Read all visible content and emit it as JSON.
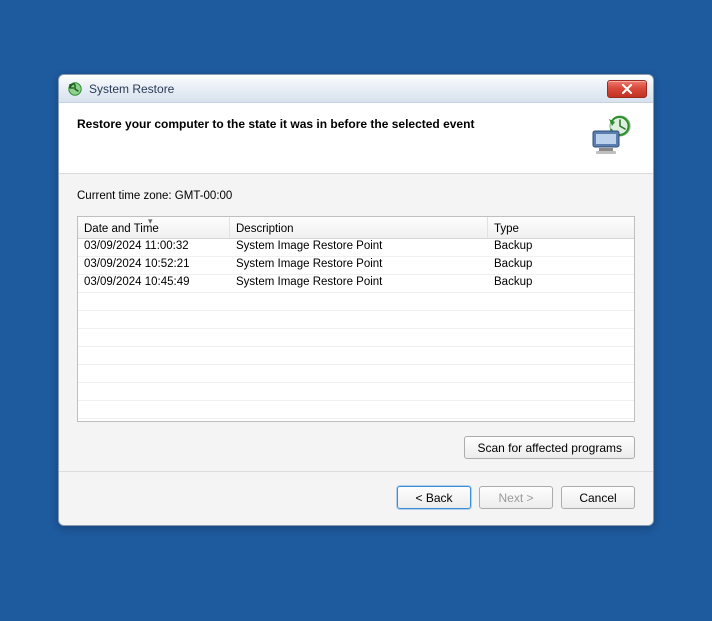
{
  "titlebar": {
    "title": "System Restore"
  },
  "header": {
    "heading": "Restore your computer to the state it was in before the selected event"
  },
  "body": {
    "timezone_label": "Current time zone: GMT-00:00",
    "columns": {
      "datetime": "Date and Time",
      "description": "Description",
      "type": "Type"
    },
    "rows": [
      {
        "datetime": "03/09/2024 11:00:32",
        "description": "System Image Restore Point",
        "type": "Backup"
      },
      {
        "datetime": "03/09/2024 10:52:21",
        "description": "System Image Restore Point",
        "type": "Backup"
      },
      {
        "datetime": "03/09/2024 10:45:49",
        "description": "System Image Restore Point",
        "type": "Backup"
      }
    ],
    "scan_button": "Scan for affected programs"
  },
  "footer": {
    "back": "< Back",
    "next": "Next >",
    "cancel": "Cancel"
  }
}
